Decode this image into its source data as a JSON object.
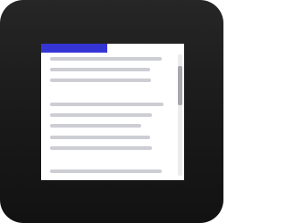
{
  "icon": {
    "name": "document-reader-app-icon",
    "background_color": "#1d1d1d",
    "sheet_color": "#ffffff",
    "text_line_color": "#cdcdd4"
  },
  "reading_progress": {
    "fraction": 0.46,
    "color": "#3535d6"
  },
  "scroll_position": {
    "visible_fraction": 0.33,
    "offset_fraction": 0.1
  }
}
